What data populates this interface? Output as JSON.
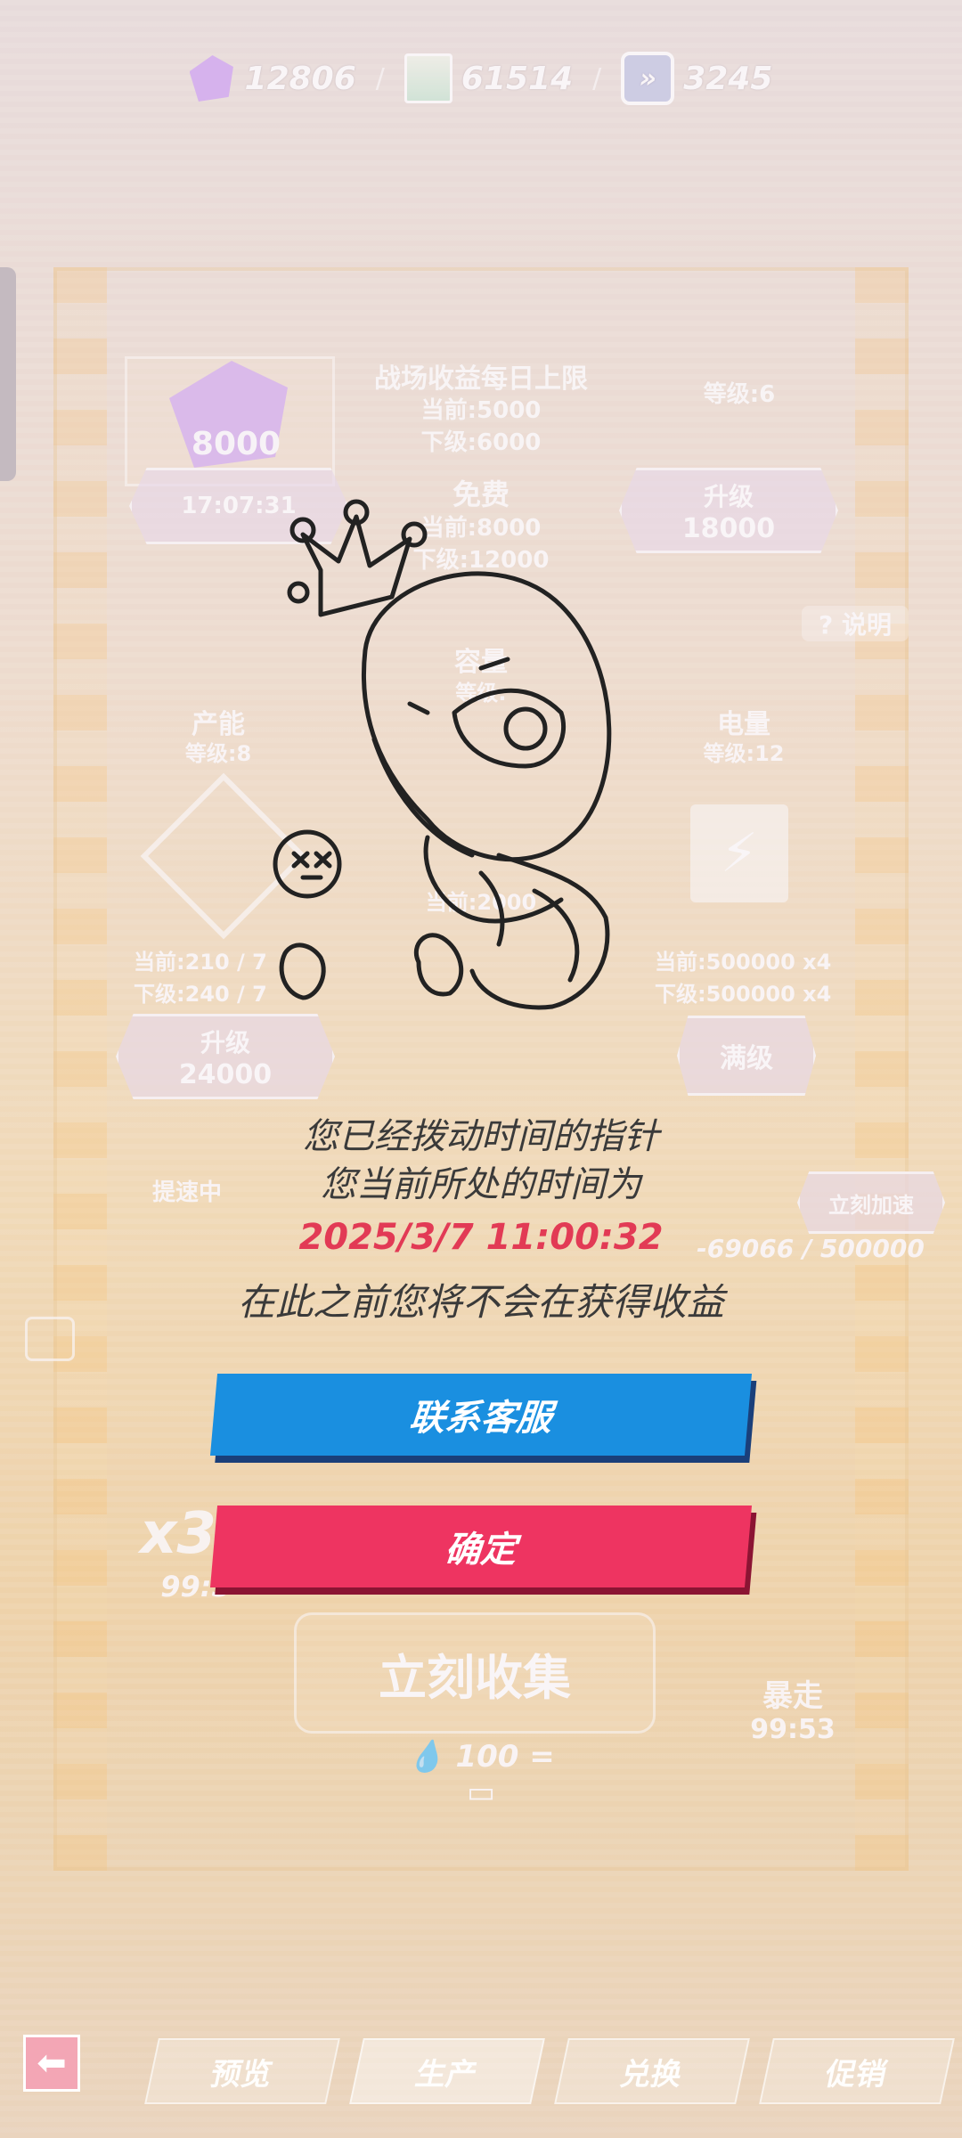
{
  "resources": [
    {
      "icon": "gem-icon",
      "value": "12806"
    },
    {
      "icon": "scroll-icon",
      "value": "61514"
    },
    {
      "icon": "boost-icon",
      "value": "3245"
    }
  ],
  "bg_ui": {
    "left_top_value": "8000",
    "left_timer": "17:07:31",
    "daily_limit_title": "战场收益每日上限",
    "daily_current": "当前:5000",
    "daily_next": "下级:6000",
    "free_label": "免费",
    "free_current": "当前:8000",
    "free_next": "下级:12000",
    "level6": "等级:6",
    "upgrade_label": "升级",
    "upgrade_cost_right": "18000",
    "help_label": "说明",
    "capacity_label": "容量",
    "capacity_level": "等级:",
    "productivity_label": "产能",
    "productivity_level": "等级:8",
    "power_label": "电量",
    "power_level": "等级:12",
    "prod_current": "当前:210 / 7",
    "prod_next": "下级:240 / 7",
    "power_current": "当前:500000 x4",
    "power_next": "下级:500000 x4",
    "cap_current": "当前:2000",
    "upgrade_cost_left": "24000",
    "maxed_label": "满级",
    "speeding_label": "提速中",
    "instant_speed_label": "立刻加速",
    "energy_readout": "-69066 / 500000",
    "collect_label": "立刻收集",
    "collect_cost": "100 =",
    "multiplier": "x3",
    "multiplier_timer": "99:5",
    "rampage_label": "暴走",
    "rampage_timer": "99:53"
  },
  "dialog": {
    "line1": "您已经拨动时间的指针",
    "line2": "您当前所处的时间为",
    "datetime": "2025/3/7 11:00:32",
    "line3": "在此之前您将不会在获得收益",
    "contact_label": "联系客服",
    "confirm_label": "确定"
  },
  "bottom_tabs": [
    "预览",
    "生产",
    "兑换",
    "促销"
  ],
  "colors": {
    "primary_blue": "#1a8fe0",
    "confirm_red": "#ee3461",
    "date_red": "#e23a55"
  }
}
